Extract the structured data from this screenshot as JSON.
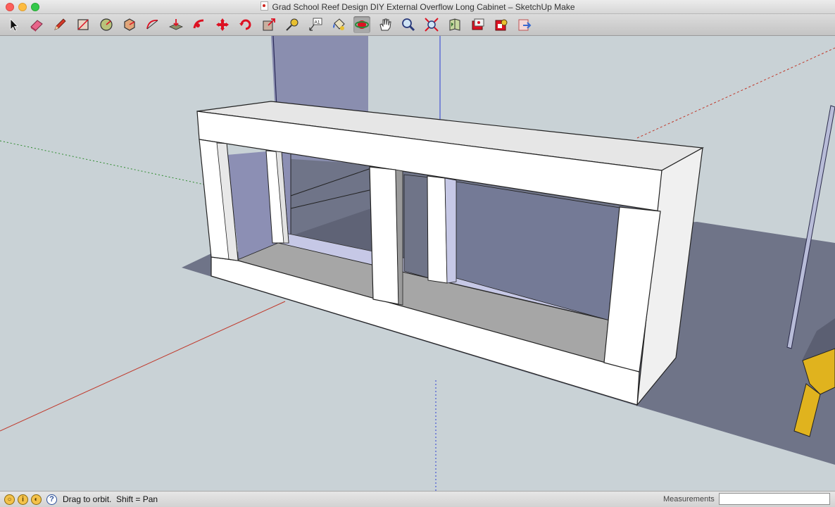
{
  "window": {
    "title": "Grad School Reef Design DIY External Overflow Long Cabinet – SketchUp Make"
  },
  "toolbar": {
    "tools": [
      {
        "name": "select-tool",
        "icon": "arrow-icon"
      },
      {
        "name": "eraser-tool",
        "icon": "eraser-icon"
      },
      {
        "name": "pencil-tool",
        "icon": "pencil-icon"
      },
      {
        "name": "rectangle-tool",
        "icon": "rectangle-icon"
      },
      {
        "name": "circle-tool",
        "icon": "circle-icon"
      },
      {
        "name": "polygon-tool",
        "icon": "polygon-icon"
      },
      {
        "name": "arc-tool",
        "icon": "arc-icon"
      },
      {
        "name": "push-pull-tool",
        "icon": "push-pull-icon"
      },
      {
        "name": "follow-me-tool",
        "icon": "follow-me-icon"
      },
      {
        "name": "move-tool",
        "icon": "move-icon"
      },
      {
        "name": "rotate-tool",
        "icon": "rotate-icon"
      },
      {
        "name": "scale-tool",
        "icon": "scale-icon"
      },
      {
        "name": "tape-measure-tool",
        "icon": "tape-measure-icon"
      },
      {
        "name": "text-tool",
        "icon": "text-icon"
      },
      {
        "name": "paint-bucket-tool",
        "icon": "paint-bucket-icon"
      },
      {
        "name": "orbit-tool",
        "icon": "orbit-icon"
      },
      {
        "name": "pan-tool",
        "icon": "hand-icon"
      },
      {
        "name": "zoom-tool",
        "icon": "magnifier-icon"
      },
      {
        "name": "zoom-extents-tool",
        "icon": "zoom-extents-icon"
      },
      {
        "name": "3d-warehouse-tool",
        "icon": "warehouse-icon"
      },
      {
        "name": "get-models-tool",
        "icon": "get-models-icon"
      },
      {
        "name": "extension-warehouse-tool",
        "icon": "extension-icon"
      },
      {
        "name": "share-model-tool",
        "icon": "share-model-icon"
      }
    ],
    "text_tool_label": "A1",
    "active_tool": "orbit-tool"
  },
  "status": {
    "text": "Drag to orbit.  Shift = Pan",
    "measurements_label": "Measurements",
    "measurements_value": ""
  },
  "colors": {
    "sky": "#c9d2d6",
    "cabinet_face": "#ffffff",
    "shelf_gray": "#a6a6a6",
    "shadow": "#6f7488",
    "back_panel": "#8c8fb4",
    "axis_red": "#c0392b",
    "axis_green": "#2e8b2e",
    "axis_blue": "#2c3ed4",
    "chair_yellow": "#e0b31e"
  }
}
